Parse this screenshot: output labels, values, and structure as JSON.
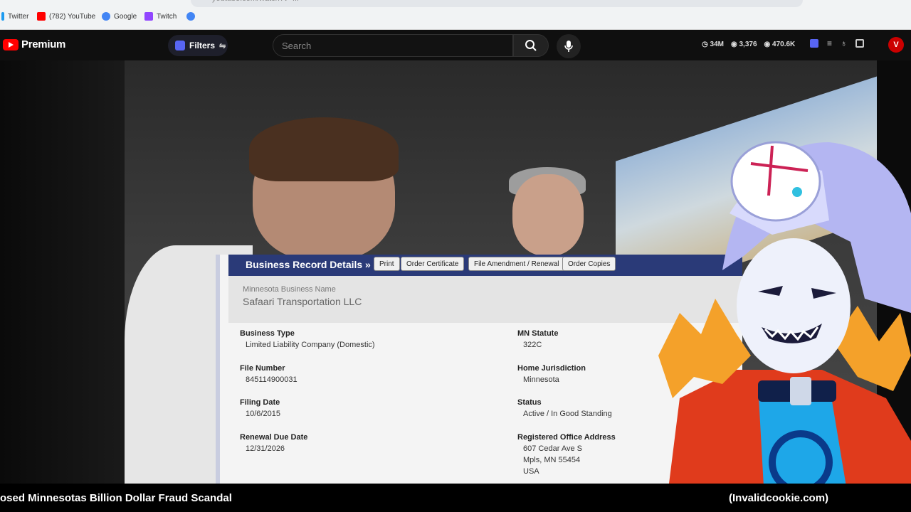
{
  "browser": {
    "url": "youtube.com/watch?v=...",
    "bookmarks": [
      {
        "label": "Twitter",
        "color": "#1d9bf0"
      },
      {
        "label": "(782) YouTube",
        "color": "#ff0000"
      },
      {
        "label": "Google",
        "color": "#4285f4"
      },
      {
        "label": "Twitch",
        "color": "#9146ff"
      },
      {
        "label": "",
        "color": "#4285f4"
      }
    ]
  },
  "header": {
    "logo": "Premium",
    "filters": "Filters",
    "search_placeholder": "Search",
    "stats": [
      "34M",
      "3,376",
      "470.6K"
    ],
    "avatar": "V"
  },
  "record": {
    "title": "Business Record Details »",
    "buttons": [
      "Print",
      "Order Certificate",
      "File Amendment / Renewal",
      "Order Copies"
    ],
    "name_label": "Minnesota Business Name",
    "name_value": "Safaari Transportation LLC",
    "fields_left": [
      {
        "label": "Business Type",
        "value": "Limited Liability Company (Domestic)"
      },
      {
        "label": "File Number",
        "value": "845114900031"
      },
      {
        "label": "Filing Date",
        "value": "10/6/2015"
      },
      {
        "label": "Renewal Due Date",
        "value": "12/31/2026"
      }
    ],
    "fields_right": [
      {
        "label": "MN Statute",
        "value": "322C"
      },
      {
        "label": "Home Jurisdiction",
        "value": "Minnesota"
      },
      {
        "label": "Status",
        "value": "Active / In Good Standing"
      },
      {
        "label": "Registered Office Address",
        "lines": [
          "607 Cedar Ave S",
          "Mpls, MN 55454",
          "USA"
        ]
      }
    ]
  },
  "video": {
    "title": "osed Minnesotas Billion Dollar Fraud Scandal",
    "caption": "(Invalidcookie.com)"
  }
}
